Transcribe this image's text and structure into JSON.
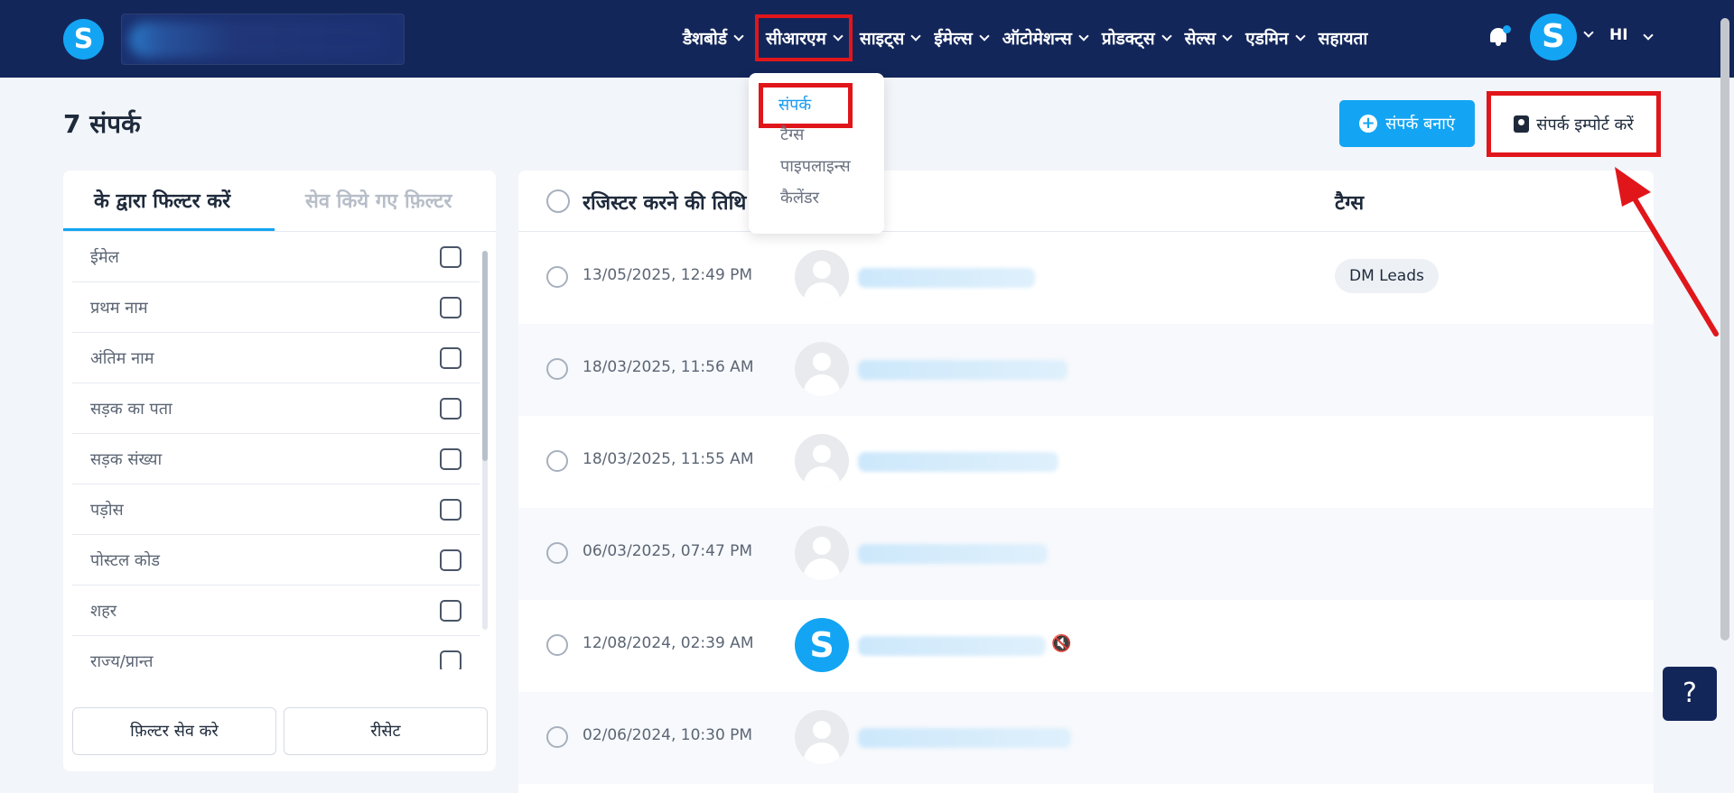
{
  "nav": {
    "items": [
      {
        "label": "डैशबोर्ड"
      },
      {
        "label": "सीआरएम"
      },
      {
        "label": "साइट्स"
      },
      {
        "label": "ईमेल्स"
      },
      {
        "label": "ऑटोमेशन्स"
      },
      {
        "label": "प्रोडक्ट्स"
      },
      {
        "label": "सेल्स"
      },
      {
        "label": "एडमिन"
      }
    ],
    "help_label": "सहायता",
    "logo_letter": "S",
    "avatar_letter": "S",
    "language": "HI"
  },
  "crm_menu": {
    "items": [
      "संपर्क",
      "टैग्स",
      "पाइपलाइन्स",
      "कैलेंडर"
    ]
  },
  "page": {
    "title": "7 संपर्क",
    "create_button": "संपर्क बनाएं",
    "import_button": "संपर्क इम्पोर्ट करें"
  },
  "filters": {
    "tab_active": "के द्वारा फिल्टर करें",
    "tab_saved": "सेव किये गए फ़िल्टर",
    "fields": [
      "ईमेल",
      "प्रथम नाम",
      "अंतिम नाम",
      "सड़क का पता",
      "सड़क संख्या",
      "पड़ोस",
      "पोस्टल कोड",
      "शहर",
      "राज्य/प्रान्त"
    ],
    "save_button": "फ़िल्टर सेव करे",
    "reset_button": "रीसेट"
  },
  "table": {
    "col_registered": "रजिस्टर करने की तिथि",
    "col_tags": "टैग्स",
    "rows": [
      {
        "date": "13/05/2025, 12:49 PM",
        "tag": "DM Leads"
      },
      {
        "date": "18/03/2025, 11:56 AM"
      },
      {
        "date": "18/03/2025, 11:55 AM"
      },
      {
        "date": "06/03/2025, 07:47 PM"
      },
      {
        "date": "12/08/2024, 02:39 AM",
        "avatar_letter": "S",
        "mute_icon": "🔇"
      },
      {
        "date": "02/06/2024, 10:30 PM"
      }
    ]
  },
  "help_button": "?",
  "colors": {
    "nav_bg": "#13265a",
    "accent": "#13a5f3",
    "highlight": "#e0161b"
  }
}
